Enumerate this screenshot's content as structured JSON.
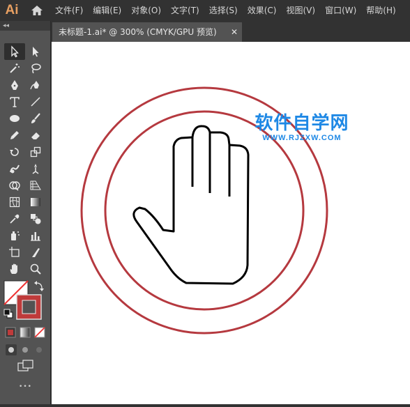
{
  "app": {
    "logo": "Ai"
  },
  "menu": {
    "items": [
      "文件(F)",
      "编辑(E)",
      "对象(O)",
      "文字(T)",
      "选择(S)",
      "效果(C)",
      "视图(V)",
      "窗口(W)",
      "帮助(H)"
    ]
  },
  "toolbar": {
    "collapse_glyph": "◂◂",
    "more_glyph": "•••",
    "tools": [
      "selection-tool",
      "direct-selection-tool",
      "magic-wand-tool",
      "lasso-tool",
      "pen-tool",
      "curvature-tool",
      "type-tool",
      "line-segment-tool",
      "ellipse-tool",
      "paintbrush-tool",
      "pencil-tool",
      "eraser-tool",
      "rotate-tool",
      "scale-tool",
      "warp-tool",
      "puppet-warp-tool",
      "shape-builder-tool",
      "perspective-grid-tool",
      "mesh-tool",
      "gradient-tool",
      "eyedropper-tool",
      "blend-tool",
      "symbol-sprayer-tool",
      "column-graph-tool",
      "artboard-tool",
      "slice-tool",
      "hand-tool",
      "zoom-tool"
    ],
    "fill_color": "#ffffff",
    "stroke_color": "#bf3b3b"
  },
  "document": {
    "tab_title": "未标题-1.ai* @ 300% (CMYK/GPU 预览)",
    "close_glyph": "✕"
  },
  "artwork": {
    "ring_color": "#b5393f",
    "hand_stroke": "#000000"
  },
  "watermark": {
    "title": "软件自学网",
    "url": "WWW.RJZXW.COM",
    "color": "#1e88e5"
  }
}
